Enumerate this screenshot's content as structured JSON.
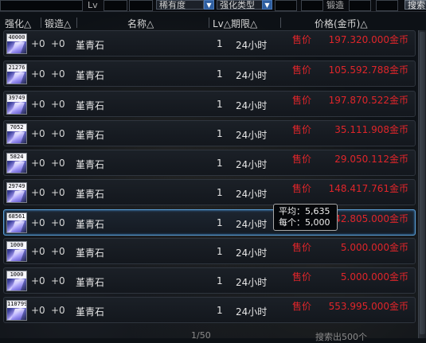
{
  "filter": {
    "lv_label": "Lv",
    "rarity_select": "稀有度",
    "enhance_type_select": "强化类型",
    "forge_label": "锻造",
    "search_button": "搜索"
  },
  "header": {
    "strengthen": "强化△",
    "forge": "锻造△",
    "name": "名称△",
    "lv_period": "Lv△期限△",
    "price": "价格(金币)△"
  },
  "rows": [
    {
      "qty": "40000",
      "strengthen": "+0",
      "forge": "+0",
      "name": "堇青石",
      "lv": "1",
      "period": "24小时",
      "sell": "售价",
      "price": "197.320.000金币"
    },
    {
      "qty": "21276",
      "strengthen": "+0",
      "forge": "+0",
      "name": "堇青石",
      "lv": "1",
      "period": "24小时",
      "sell": "售价",
      "price": "105.592.788金币"
    },
    {
      "qty": "39749",
      "strengthen": "+0",
      "forge": "+0",
      "name": "堇青石",
      "lv": "1",
      "period": "24小时",
      "sell": "售价",
      "price": "197.870.522金币"
    },
    {
      "qty": "7052",
      "strengthen": "+0",
      "forge": "+0",
      "name": "堇青石",
      "lv": "1",
      "period": "24小时",
      "sell": "售价",
      "price": "35.111.908金币"
    },
    {
      "qty": "5824",
      "strengthen": "+0",
      "forge": "+0",
      "name": "堇青石",
      "lv": "1",
      "period": "24小时",
      "sell": "售价",
      "price": "29.050.112金币"
    },
    {
      "qty": "29749",
      "strengthen": "+0",
      "forge": "+0",
      "name": "堇青石",
      "lv": "1",
      "period": "24小时",
      "sell": "售价",
      "price": "148.417.761金币"
    },
    {
      "qty": "68561",
      "strengthen": "+0",
      "forge": "+0",
      "name": "堇青石",
      "lv": "1",
      "period": "24小时",
      "sell": "售价",
      "price": "342.805.000金币"
    },
    {
      "qty": "1000",
      "strengthen": "+0",
      "forge": "+0",
      "name": "堇青石",
      "lv": "1",
      "period": "24小时",
      "sell": "售价",
      "price": "5.000.000金币"
    },
    {
      "qty": "1000",
      "strengthen": "+0",
      "forge": "+0",
      "name": "堇青石",
      "lv": "1",
      "period": "24小时",
      "sell": "售价",
      "price": "5.000.000金币"
    },
    {
      "qty": "110799",
      "strengthen": "+0",
      "forge": "+0",
      "name": "堇青石",
      "lv": "1",
      "period": "24小时",
      "sell": "售价",
      "price": "553.995.000金币"
    }
  ],
  "tooltip": {
    "line1": "平均：5,635",
    "line2": "每个：5,000"
  },
  "footer": {
    "page": "1/50",
    "total": "搜索出500个"
  }
}
